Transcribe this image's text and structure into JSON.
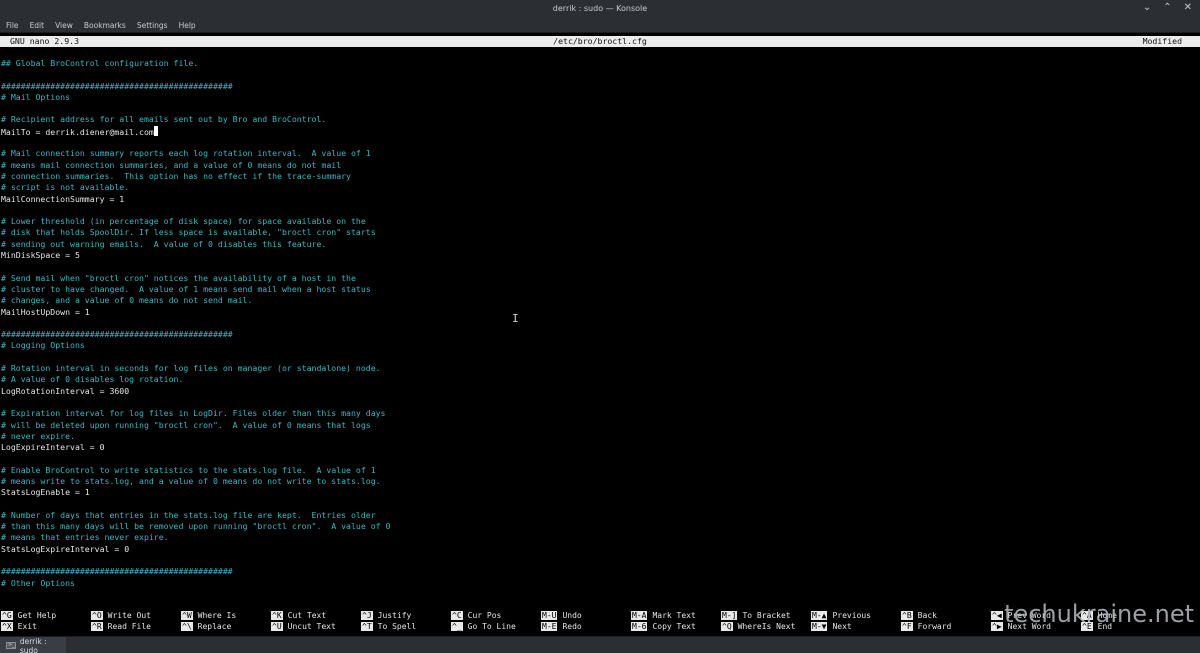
{
  "window": {
    "title": "derrik : sudo — Konsole",
    "controls": [
      "⌄",
      "⌃",
      "✕"
    ]
  },
  "menubar": [
    "File",
    "Edit",
    "View",
    "Bookmarks",
    "Settings",
    "Help"
  ],
  "nano": {
    "version": "GNU nano 2.9.3",
    "filename": "/etc/bro/broctl.cfg",
    "state": "Modified"
  },
  "file_lines": [
    {
      "text": "## Global BroControl configuration file.",
      "type": "comment"
    },
    {
      "text": "",
      "type": "blank"
    },
    {
      "text": "###############################################",
      "type": "comment"
    },
    {
      "text": "# Mail Options",
      "type": "comment"
    },
    {
      "text": "",
      "type": "blank"
    },
    {
      "text": "# Recipient address for all emails sent out by Bro and BroControl.",
      "type": "comment"
    },
    {
      "text": "MailTo = derrik.diener@mail.com",
      "type": "setting",
      "cursor": true
    },
    {
      "text": "",
      "type": "blank"
    },
    {
      "text": "# Mail connection summary reports each log rotation interval.  A value of 1",
      "type": "comment"
    },
    {
      "text": "# means mail connection summaries, and a value of 0 means do not mail",
      "type": "comment"
    },
    {
      "text": "# connection summaries.  This option has no effect if the trace-summary",
      "type": "comment"
    },
    {
      "text": "# script is not available.",
      "type": "comment"
    },
    {
      "text": "MailConnectionSummary = 1",
      "type": "setting"
    },
    {
      "text": "",
      "type": "blank"
    },
    {
      "text": "# Lower threshold (in percentage of disk space) for space available on the",
      "type": "comment"
    },
    {
      "text": "# disk that holds SpoolDir. If less space is available, \"broctl cron\" starts",
      "type": "comment"
    },
    {
      "text": "# sending out warning emails.  A value of 0 disables this feature.",
      "type": "comment"
    },
    {
      "text": "MinDiskSpace = 5",
      "type": "setting"
    },
    {
      "text": "",
      "type": "blank"
    },
    {
      "text": "# Send mail when \"broctl cron\" notices the availability of a host in the",
      "type": "comment"
    },
    {
      "text": "# cluster to have changed.  A value of 1 means send mail when a host status",
      "type": "comment"
    },
    {
      "text": "# changes, and a value of 0 means do not send mail.",
      "type": "comment"
    },
    {
      "text": "MailHostUpDown = 1",
      "type": "setting"
    },
    {
      "text": "",
      "type": "blank"
    },
    {
      "text": "###############################################",
      "type": "comment"
    },
    {
      "text": "# Logging Options",
      "type": "comment"
    },
    {
      "text": "",
      "type": "blank"
    },
    {
      "text": "# Rotation interval in seconds for log files on manager (or standalone) node.",
      "type": "comment"
    },
    {
      "text": "# A value of 0 disables log rotation.",
      "type": "comment"
    },
    {
      "text": "LogRotationInterval = 3600",
      "type": "setting"
    },
    {
      "text": "",
      "type": "blank"
    },
    {
      "text": "# Expiration interval for log files in LogDir. Files older than this many days",
      "type": "comment"
    },
    {
      "text": "# will be deleted upon running \"broctl cron\".  A value of 0 means that logs",
      "type": "comment"
    },
    {
      "text": "# never expire.",
      "type": "comment"
    },
    {
      "text": "LogExpireInterval = 0",
      "type": "setting"
    },
    {
      "text": "",
      "type": "blank"
    },
    {
      "text": "# Enable BroControl to write statistics to the stats.log file.  A value of 1",
      "type": "comment"
    },
    {
      "text": "# means write to stats.log, and a value of 0 means do not write to stats.log.",
      "type": "comment"
    },
    {
      "text": "StatsLogEnable = 1",
      "type": "setting"
    },
    {
      "text": "",
      "type": "blank"
    },
    {
      "text": "# Number of days that entries in the stats.log file are kept.  Entries older",
      "type": "comment"
    },
    {
      "text": "# than this many days will be removed upon running \"broctl cron\".  A value of 0",
      "type": "comment"
    },
    {
      "text": "# means that entries never expire.",
      "type": "comment"
    },
    {
      "text": "StatsLogExpireInterval = 0",
      "type": "setting"
    },
    {
      "text": "",
      "type": "blank"
    },
    {
      "text": "###############################################",
      "type": "comment"
    },
    {
      "text": "# Other Options",
      "type": "comment"
    }
  ],
  "shortcuts": [
    [
      {
        "key": "^G",
        "label": "Get Help"
      },
      {
        "key": "^X",
        "label": "Exit"
      }
    ],
    [
      {
        "key": "^O",
        "label": "Write Out"
      },
      {
        "key": "^R",
        "label": "Read File"
      }
    ],
    [
      {
        "key": "^W",
        "label": "Where Is"
      },
      {
        "key": "^\\",
        "label": "Replace"
      }
    ],
    [
      {
        "key": "^K",
        "label": "Cut Text"
      },
      {
        "key": "^U",
        "label": "Uncut Text"
      }
    ],
    [
      {
        "key": "^J",
        "label": "Justify"
      },
      {
        "key": "^T",
        "label": "To Spell"
      }
    ],
    [
      {
        "key": "^C",
        "label": "Cur Pos"
      },
      {
        "key": "^_",
        "label": "Go To Line"
      }
    ],
    [
      {
        "key": "M-U",
        "label": "Undo"
      },
      {
        "key": "M-E",
        "label": "Redo"
      }
    ],
    [
      {
        "key": "M-A",
        "label": "Mark Text"
      },
      {
        "key": "M-6",
        "label": "Copy Text"
      }
    ],
    [
      {
        "key": "M-]",
        "label": "To Bracket"
      },
      {
        "key": "^Q",
        "label": "WhereIs Next"
      }
    ],
    [
      {
        "key": "M-▲",
        "label": "Previous"
      },
      {
        "key": "M-▼",
        "label": "Next"
      }
    ],
    [
      {
        "key": "^B",
        "label": "Back"
      },
      {
        "key": "^F",
        "label": "Forward"
      }
    ],
    [
      {
        "key": "^◀",
        "label": "Prev Word"
      },
      {
        "key": "^▶",
        "label": "Next Word"
      }
    ],
    [
      {
        "key": "^A",
        "label": "Home"
      },
      {
        "key": "^E",
        "label": "End"
      }
    ]
  ],
  "tab": {
    "label": "derrik : sudo",
    "icon": "terminal-icon"
  },
  "watermark": "techukraine.net"
}
